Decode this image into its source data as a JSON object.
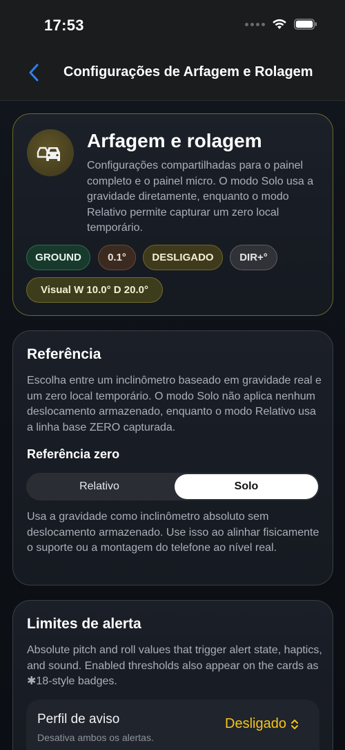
{
  "status": {
    "time": "17:53"
  },
  "nav": {
    "title": "Configurações de Arfagem e Rolagem"
  },
  "hero": {
    "title": "Arfagem e rolagem",
    "description": "Configurações compartilhadas para o painel completo e o painel micro. O modo Solo usa a gravidade diretamente, enquanto o modo Relativo permite capturar um zero local temporário.",
    "chips": {
      "ground": "GROUND",
      "step": "0.1°",
      "off": "DESLIGADO",
      "dir": "DIR+°",
      "visual": "Visual W 10.0°  D 20.0°"
    }
  },
  "reference": {
    "title": "Referência",
    "description": "Escolha entre um inclinômetro baseado em gravidade real e um zero local temporário. O modo Solo não aplica nenhum deslocamento armazenado, enquanto o modo Relativo usa a linha base ZERO capturada.",
    "zero_title": "Referência zero",
    "options": {
      "relative": "Relativo",
      "solo": "Solo"
    },
    "selected": "Solo",
    "help": "Usa a gravidade como inclinômetro absoluto sem deslocamento armazenado. Use isso ao alinhar fisicamente o suporte ou a montagem do telefone ao nível real."
  },
  "limits": {
    "title": "Limites de alerta",
    "description": "Absolute pitch and roll values that trigger alert state, haptics, and sound. Enabled thresholds also appear on the cards as ✱18-style badges.",
    "warning_profile": {
      "label": "Perfil de aviso",
      "sub": "Desativa ambos os alertas.",
      "value": "Desligado"
    }
  },
  "colors": {
    "accent_yellow": "#f5c518",
    "back_blue": "#2f80ed"
  }
}
